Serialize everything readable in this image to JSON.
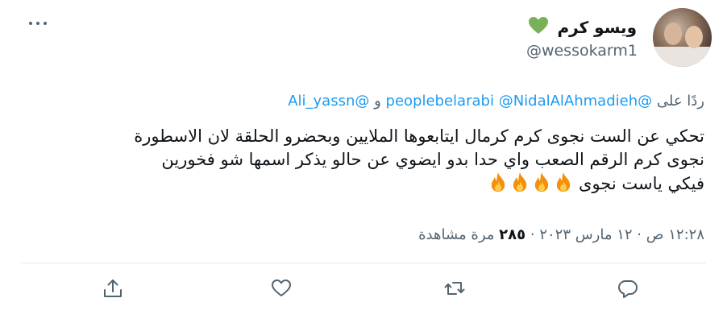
{
  "author": {
    "display_name": "ويسو كرم",
    "handle": "@wessokarm1",
    "name_emoji": "green-heart"
  },
  "reply_context": {
    "prefix": "ردًا على",
    "mentions": [
      "@peoplebelarabi",
      "@NidalAlAhmadieh",
      "@Ali_yassn"
    ],
    "conjunction": "و"
  },
  "tweet": {
    "lines": [
      "تحكي عن الست نجوى كرم كرمال ايتابعوها الملايين وبحضرو الحلقة لان الاسطورة",
      "نجوى كرم الرقم الصعب واي حدا بدو ايضوي عن حالو يذكر اسمها شو فخورين",
      "فيكي ياست نجوى"
    ],
    "emoji": "fire",
    "emoji_count": 4
  },
  "meta": {
    "time": "١٢:٢٨ ص",
    "date": "١٢ مارس ٢٠٢٣",
    "separator": "·",
    "views": "٢٨٥",
    "views_label": "مرة مشاهدة"
  },
  "actions": {
    "reply": "reply-icon",
    "retweet": "retweet-icon",
    "like": "heart-icon",
    "share": "share-icon"
  },
  "colors": {
    "link": "#1d9bf0",
    "secondary": "#536471",
    "text": "#0f1419",
    "heart_emoji": "#78b159",
    "fire_emoji": "#f4900c"
  }
}
